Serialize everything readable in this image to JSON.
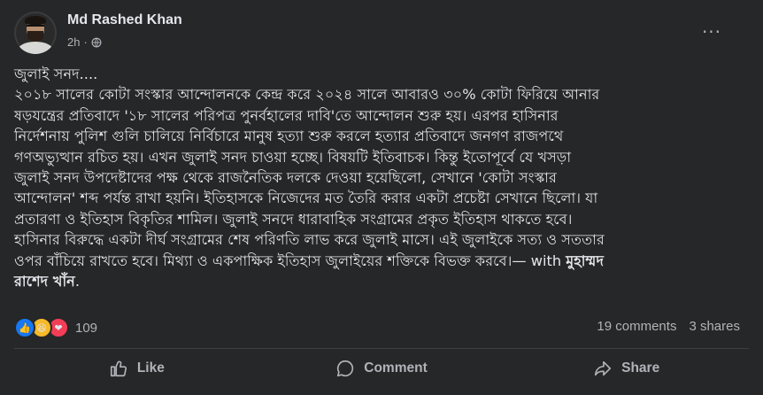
{
  "post": {
    "author": "Md Rashed Khan",
    "time": "2h",
    "separator": "·",
    "privacy_icon": "globe-icon",
    "more_icon": "more-horizontal-icon",
    "more_label": "···",
    "body_lines": [
      "জুলাই সনদ....",
      "২০১৮ সালের কোটা সংস্কার আন্দোলনকে কেন্দ্র করে ২০২৪ সালে আবারও ৩০% কোটা ফিরিয়ে আনার",
      "ষড়যন্ত্রের প্রতিবাদে '১৮ সালের পরিপত্র পুনর্বহালের দাবি'তে আন্দোলন শুরু হয়। এরপর হাসিনার",
      "নির্দেশনায় পুলিশ গুলি চালিয়ে নির্বিচারে মানুষ হত্যা শুরু করলে হত্যার প্রতিবাদে জনগণ রাজপথে",
      "গণঅভ্যুত্থান রচিত হয়। এখন জুলাই সনদ চাওয়া হচ্ছে। বিষয়টি ইতিবাচক। কিন্তু ইতোপূর্বে যে খসড়া",
      "জুলাই সনদ উপদেষ্টাদের পক্ষ থেকে রাজনৈতিক দলকে দেওয়া হয়েছিলো, সেখানে 'কোটা সংস্কার",
      "আন্দোলন' শব্দ পর্যন্ত রাখা হয়নি। ইতিহাসকে নিজেদের মত তৈরি করার একটা প্রচেষ্টা সেখানে ছিলো। যা",
      "প্রতারণা ও ইতিহাস বিকৃতির শামিল। জুলাই সনদে ধারাবাহিক সংগ্রামের প্রকৃত ইতিহাস থাকতে হবে।",
      "হাসিনার বিরুদ্ধে একটা দীর্ঘ সংগ্রামের শেষ পরিণতি লাভ করে জুলাই মাসে। এই জুলাইকে সত্য ও সততার",
      "ওপর বাঁচিয়ে রাখতে হবে। মিথ্যা ও একপাক্ষিক ইতিহাস জুলাইয়ের শক্তিকে বিভক্ত করবে।— with"
    ],
    "mention_inline": "মুহাম্মদ",
    "mention_second_line": "রাশেদ খাঁন",
    "mention_end": "."
  },
  "engagement": {
    "reactions": [
      {
        "name": "like",
        "icon": "thumbs-up-reaction-icon",
        "glyph": "👍"
      },
      {
        "name": "haha",
        "icon": "laughing-face-reaction-icon",
        "glyph": "😆"
      },
      {
        "name": "love",
        "icon": "heart-reaction-icon",
        "glyph": "❤"
      }
    ],
    "reaction_count": "109",
    "comments": "19 comments",
    "shares": "3 shares"
  },
  "actions": {
    "like": "Like",
    "comment": "Comment",
    "share": "Share"
  },
  "colors": {
    "background": "#252728",
    "text": "#e4e6eb",
    "muted": "#b0b3b8",
    "like_blue": "#1877f2",
    "haha_yellow": "#f7b928",
    "love_red": "#f33e58"
  }
}
